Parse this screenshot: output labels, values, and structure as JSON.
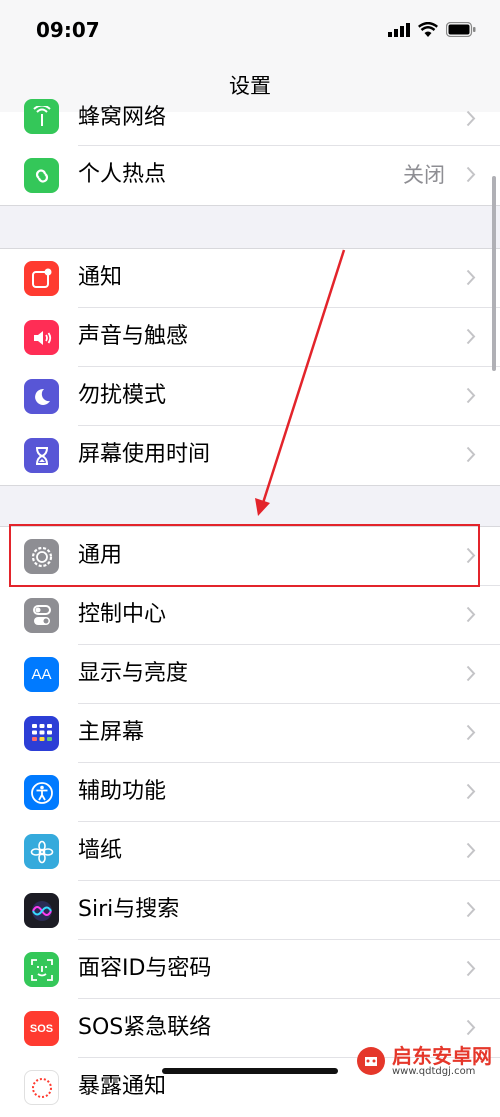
{
  "status_bar": {
    "time": "09:07"
  },
  "nav": {
    "title": "设置"
  },
  "rows": {
    "cellular": "蜂窝网络",
    "hotspot": "个人热点",
    "hotspot_value": "关闭",
    "notifications": "通知",
    "sounds": "声音与触感",
    "dnd": "勿扰模式",
    "screen_time": "屏幕使用时间",
    "general": "通用",
    "control_center": "控制中心",
    "display": "显示与亮度",
    "home_screen": "主屏幕",
    "accessibility": "辅助功能",
    "wallpaper": "墙纸",
    "siri": "Siri与搜索",
    "face_id": "面容ID与密码",
    "sos": "SOS紧急联络",
    "exposure": "暴露通知"
  },
  "icon_texts": {
    "display": "AA",
    "sos": "SOS"
  },
  "watermark": {
    "name": "启东安卓网",
    "url": "www.qdtdgj.com"
  },
  "colors": {
    "green": "#34c759",
    "red": "#ff3b30",
    "pink_red": "#ff2d55",
    "indigo": "#5856d6",
    "gray": "#8e8e93",
    "blue": "#007aff",
    "annotation_red": "#e3242b"
  }
}
